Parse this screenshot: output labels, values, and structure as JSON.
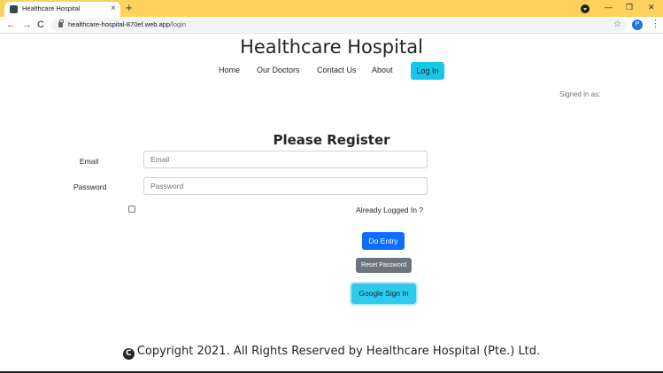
{
  "browser": {
    "tab_title": "Healthcare Hospital",
    "tab_close": "×",
    "new_tab": "+",
    "url_host": "healthcare-hospital-870ef.web.app",
    "url_path": "/login",
    "profile_initial": "P",
    "icons": {
      "back": "←",
      "forward": "→",
      "reload": "C",
      "star": "☆",
      "menu": "⋮",
      "minimize": "—",
      "restore": "❐",
      "close": "✕"
    }
  },
  "header": {
    "title": "Healthcare Hospital",
    "nav": [
      "Home",
      "Our Doctors",
      "Contact Us",
      "About"
    ],
    "login_button": "Log In",
    "signed_in": "Signed in as:"
  },
  "form": {
    "title": "Please Register",
    "email_label": "Email",
    "email_placeholder": "Email",
    "password_label": "Password",
    "password_placeholder": "Password",
    "already_logged_in": "Already Logged In ?",
    "entry_button": "Do Entry",
    "reset_button": "Reset Password",
    "google_button": "Google Sign In"
  },
  "footer": {
    "copyright_icon": "C",
    "text": "Copyright 2021. All Rights Reserved by Healthcare Hospital (Pte.) Ltd."
  },
  "colors": {
    "chrome_frame": "#fcd15c",
    "login_button": "#16c7e9",
    "primary": "#0d6efd",
    "secondary": "#6c757d",
    "google_button": "#2dccef"
  }
}
